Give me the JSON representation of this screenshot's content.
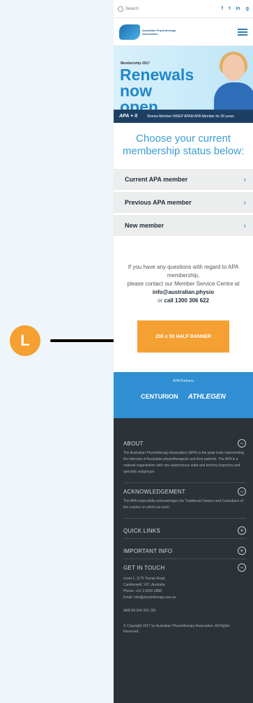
{
  "callout": {
    "letter": "L"
  },
  "topbar": {
    "search_placeholder": "Search",
    "socials": [
      "f",
      "t",
      "in",
      "g"
    ]
  },
  "header": {
    "logo_text": "Australian Physiotherapy Association"
  },
  "banner": {
    "kicker": "Membership 2017",
    "headline": "Renewals now open.",
    "strip_brand": "APA + it",
    "strip_text": "Renew Member INSEP APAM APA Member for 30 years"
  },
  "choose_title": "Choose your current membership status below:",
  "options": [
    {
      "label": "Current APA member"
    },
    {
      "label": "Previous APA member"
    },
    {
      "label": "New member"
    }
  ],
  "info": {
    "line1": "If you have any questions with regard to APA membership,",
    "line2": "please contact our Member Service Centre at",
    "email": "info@australian.physio",
    "or": "or",
    "phone": "call 1300 306 622"
  },
  "half_banner": {
    "label": "236 x 50 HALF BANNER"
  },
  "partners": {
    "label": "APA Partners",
    "logo1": "CENTURION",
    "logo2": "ATHLEGEN"
  },
  "footer": {
    "about": {
      "title": "ABOUT",
      "body": "The Australian Physiotherapy Association (APA) is the peak body representing the interests of Australian physiotherapists and their patients. The APA is a national organisation with non-autonomous state and territory branches and specialty subgroups."
    },
    "acknowledgement": {
      "title": "ACKNOWLEDGEMENT",
      "body": "The APA respectfully acknowledges the Traditional Owners and Custodians of the country on which we work."
    },
    "quick_links": {
      "title": "QUICK LINKS"
    },
    "important_info": {
      "title": "IMPORTANT INFO"
    },
    "get_in_touch": {
      "title": "GET IN TOUCH",
      "items": [
        "Level 1, 1175 Toorak Road,",
        "Camberwell, VIC, Australia",
        "Phone: +61 3 9092 0888",
        "Email: info@physiotherapy.asn.au"
      ]
    },
    "abn": "ABN 89 004 265 150",
    "copyright": "© Copyright 2017 by Australian Physiotherapy Association. All Rights Reserved."
  }
}
